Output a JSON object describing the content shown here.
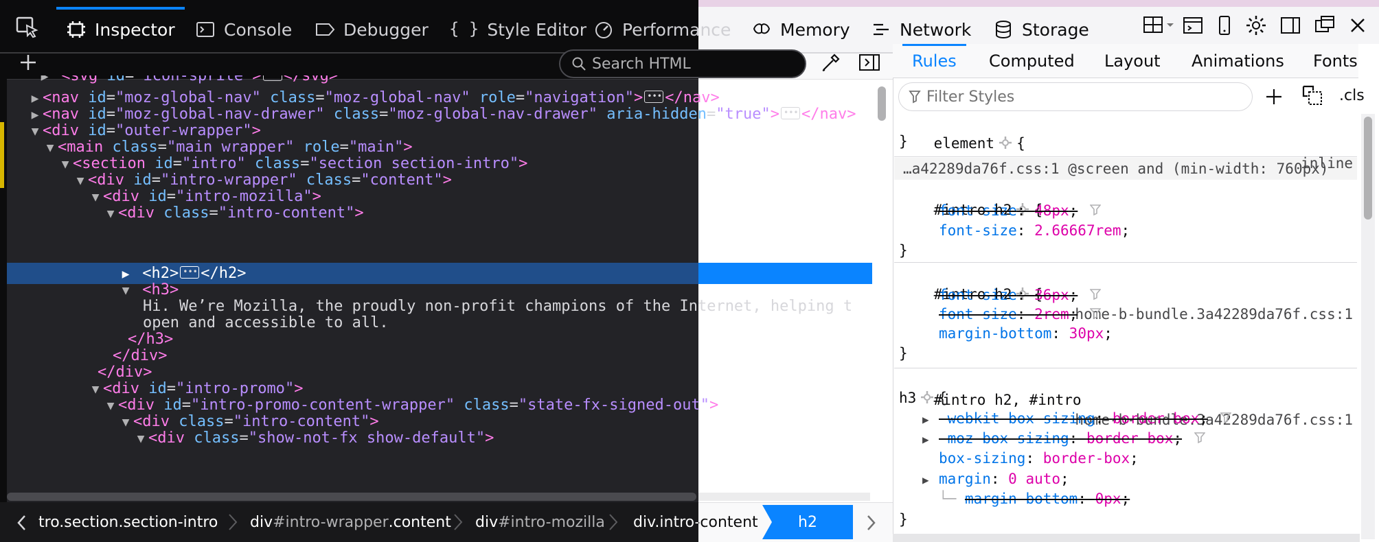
{
  "tabs": {
    "inspector": "Inspector",
    "console": "Console",
    "debugger": "Debugger",
    "style_editor": "Style Editor",
    "performance": "Performance",
    "memory": "Memory",
    "network": "Network",
    "storage": "Storage"
  },
  "search_html_placeholder": "Search HTML",
  "markup_lines": [
    {
      "l1": "<svg id=\"icon-sprite\">",
      "l2": "</svg>"
    },
    {
      "tag": "nav",
      "id": "moz-global-nav",
      "class": "moz-global-nav",
      "role": "navigation",
      "close": "</nav>"
    },
    {
      "tag": "nav",
      "id": "moz-global-nav-drawer",
      "class": "moz-global-nav-drawer",
      "aria_attr": "aria-hidden",
      "aria": "true",
      "close": "</nav>"
    },
    {
      "tag": "div",
      "id": "outer-wrapper"
    },
    {
      "tag": "main",
      "class": "main wrapper",
      "role": "main"
    },
    {
      "tag": "section",
      "id": "intro",
      "class": "section section-intro"
    },
    {
      "tag": "div",
      "id": "intro-wrapper",
      "class": "content"
    },
    {
      "tag": "div",
      "id": "intro-mozilla"
    },
    {
      "tag": "div",
      "class": "intro-content"
    },
    {
      "open": "<h2>",
      "close": "</h2>"
    },
    {
      "open": "<h3>"
    },
    {
      "text": "Hi. We’re Mozilla, the proudly non-profit champions of the Internet, helping t"
    },
    {
      "text": "open and accessible to all."
    },
    {
      "close": "</h3>"
    },
    {
      "close": "</div>"
    },
    {
      "close": "</div>"
    },
    {
      "tag": "div",
      "id": "intro-promo"
    },
    {
      "tag": "div",
      "id": "intro-promo-content-wrapper",
      "class": "state-fx-signed-out"
    },
    {
      "tag": "div",
      "class": "intro-content"
    },
    {
      "tag": "div",
      "class": "show-not-fx show-default"
    }
  ],
  "attr_names": {
    "id": "id",
    "class": "class",
    "role": "role"
  },
  "breadcrumbs": {
    "c1": "tro.section.section-intro",
    "c2_tag": "div",
    "c2_id": "#intro-wrapper",
    "c2_cls": ".content",
    "c3_tag": "div",
    "c3_id": "#intro-mozilla",
    "c4": "div.intro-content",
    "current": "h2"
  },
  "rules_tabs": {
    "rules": "Rules",
    "computed": "Computed",
    "layout": "Layout",
    "animations": "Animations",
    "fonts": "Fonts"
  },
  "filter_placeholder": "Filter Styles",
  "cls_label": ".cls",
  "rules": {
    "element_selector": "element",
    "element_src": "inline",
    "media_text": "…a42289da76f.css:1 @screen and (min-width: 760px)",
    "r1_selector": "#intro h2",
    "r1_p1_name": "font-size",
    "r1_p1_val": "48px",
    "r1_p2_name": "font-size",
    "r1_p2_val": "2.66667rem",
    "r2_selector": "#intro h2",
    "r2_src": "home-b-bundle.3a42289da76f.css:1",
    "r2_p1_name": "font-size",
    "r2_p1_val": "36px",
    "r2_p2_name": "font-size",
    "r2_p2_val": "2rem",
    "r2_p3_name": "margin-bottom",
    "r2_p3_val": "30px",
    "r3_selector_a": "#intro h2, #intro",
    "r3_selector_b": "h3",
    "r3_src": "home-b-bundle.3a42289da76f.css:1",
    "r3_p1_name": "-webkit-box-sizing",
    "r3_p1_val": "border-box",
    "r3_p2_name": "-moz-box-sizing",
    "r3_p2_val": "border-box",
    "r3_p3_name": "box-sizing",
    "r3_p3_val": "border-box",
    "r3_p4_name": "margin",
    "r3_p4_val": "0 auto",
    "r3_p5_name": "margin-bottom",
    "r3_p5_val": "0px"
  },
  "icons": [
    "element-picker-icon",
    "inspector-icon",
    "console-icon",
    "debugger-icon",
    "style-editor-icon",
    "performance-icon",
    "memory-icon",
    "network-icon",
    "storage-icon",
    "responsive-design-icon",
    "screenshot-icon",
    "settings-icon",
    "dock-side-icon",
    "undock-icon",
    "close-icon",
    "add-node-icon",
    "search-icon",
    "eyedropper-icon",
    "toggle-sidebar-icon",
    "filter-icon",
    "add-rule-icon",
    "print-simulation-icon",
    "gear-icon"
  ],
  "colors": {
    "accent": "#0a84ff",
    "dark_bg": "#232327",
    "tag": "#ff7de9",
    "attr": "#75bfff",
    "attr_value": "#b98eff",
    "prop_name": "#0074e8",
    "prop_value": "#dd00a9"
  }
}
